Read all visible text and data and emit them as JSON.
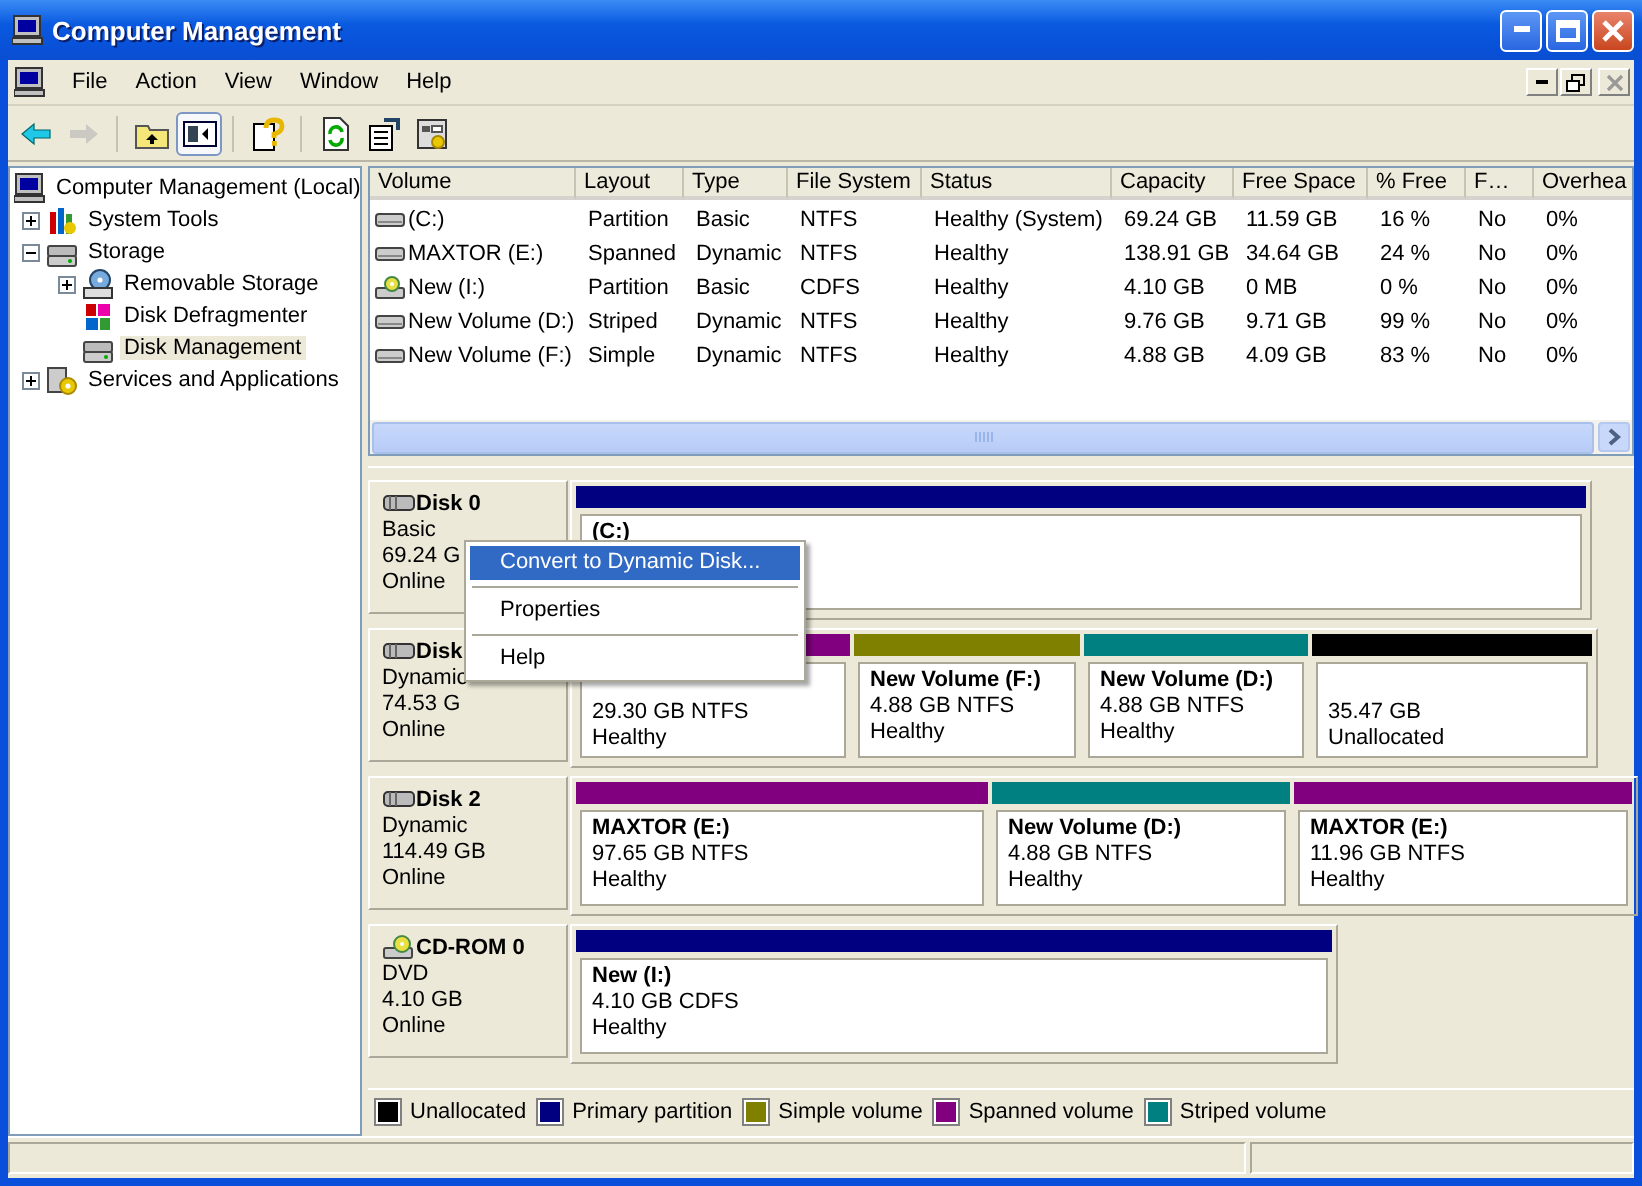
{
  "window": {
    "title": "Computer Management"
  },
  "menu": [
    "File",
    "Action",
    "View",
    "Window",
    "Help"
  ],
  "toolbar": [
    [
      {
        "kind": "back",
        "disabled": false,
        "pressed": false
      },
      {
        "kind": "forward",
        "disabled": true,
        "pressed": false
      }
    ],
    [
      {
        "kind": "up",
        "disabled": false,
        "pressed": false
      },
      {
        "kind": "tree",
        "disabled": false,
        "pressed": true
      }
    ],
    [
      {
        "kind": "help",
        "disabled": false,
        "pressed": false
      }
    ],
    [
      {
        "kind": "refresh",
        "disabled": false,
        "pressed": false
      },
      {
        "kind": "export",
        "disabled": false,
        "pressed": false
      },
      {
        "kind": "properties",
        "disabled": false,
        "pressed": false
      }
    ]
  ],
  "tree": [
    {
      "label": "Computer Management (Local)",
      "selected": false,
      "children": [
        {
          "label": "System Tools",
          "expanded": false,
          "selected": false
        },
        {
          "label": "Storage",
          "expanded": true,
          "selected": false,
          "children": [
            {
              "label": "Removable Storage",
              "expanded": false,
              "selected": false
            },
            {
              "label": "Disk Defragmenter",
              "selected": false
            },
            {
              "label": "Disk Management",
              "selected": true
            }
          ]
        },
        {
          "label": "Services and Applications",
          "expanded": false,
          "selected": false
        }
      ]
    }
  ],
  "volumes_table": {
    "columns": [
      "Volume",
      "Layout",
      "Type",
      "File System",
      "Status",
      "Capacity",
      "Free Space",
      "% Free",
      "F…",
      "Overhea"
    ],
    "rows": [
      {
        "cells": [
          " (C:)",
          "Partition",
          "Basic",
          "NTFS",
          "Healthy (System)",
          "69.24 GB",
          "11.59 GB",
          "16 %",
          "No",
          "0%"
        ]
      },
      {
        "cells": [
          "MAXTOR (E:)",
          "Spanned",
          "Dynamic",
          "NTFS",
          "Healthy",
          "138.91 GB",
          "34.64 GB",
          "24 %",
          "No",
          "0%"
        ]
      },
      {
        "cells": [
          "New (I:)",
          "Partition",
          "Basic",
          "CDFS",
          "Healthy",
          "4.10 GB",
          "0 MB",
          "0 %",
          "No",
          "0%"
        ]
      },
      {
        "cells": [
          "New Volume (D:)",
          "Striped",
          "Dynamic",
          "NTFS",
          "Healthy",
          "9.76 GB",
          "9.71 GB",
          "99 %",
          "No",
          "0%"
        ]
      },
      {
        "cells": [
          "New Volume (F:)",
          "Simple",
          "Dynamic",
          "NTFS",
          "Healthy",
          "4.88 GB",
          "4.09 GB",
          "83 %",
          "No",
          "0%"
        ]
      }
    ]
  },
  "disks": [
    {
      "name": "Disk 0",
      "type": "Basic",
      "capacity": "69.24 G",
      "status": "Online",
      "volumes": [
        {
          "color": "#000080",
          "name": "(C:)"
        }
      ]
    },
    {
      "name": "Disk",
      "type": "Dynamic",
      "capacity": "74.53 G",
      "status": "Online",
      "volumes": [
        {
          "color": "#800080",
          "size": "29.30 GB NTFS",
          "status": "Healthy"
        },
        {
          "color": "#808000",
          "name": "New Volume  (F:)",
          "size": "4.88 GB NTFS",
          "status": "Healthy"
        },
        {
          "color": "#008080",
          "name": "New Volume  (D:)",
          "size": "4.88 GB NTFS",
          "status": "Healthy"
        },
        {
          "color": "#000000",
          "size": "35.47 GB",
          "status": "Unallocated"
        }
      ]
    },
    {
      "name": "Disk 2",
      "type": "Dynamic",
      "capacity": "114.49 GB",
      "status": "Online",
      "volumes": [
        {
          "color": "#800080",
          "name": "MAXTOR  (E:)",
          "size": "97.65 GB NTFS",
          "status": "Healthy"
        },
        {
          "color": "#008080",
          "name": "New Volume  (D:)",
          "size": "4.88 GB NTFS",
          "status": "Healthy"
        },
        {
          "color": "#800080",
          "name": "MAXTOR  (E:)",
          "size": "11.96 GB NTFS",
          "status": "Healthy"
        }
      ]
    },
    {
      "name": "CD-ROM 0",
      "type": "DVD",
      "capacity": "4.10 GB",
      "status": "Online",
      "volumes": [
        {
          "color": "#000080",
          "name": "New  (I:)",
          "size": "4.10 GB CDFS",
          "status": "Healthy"
        }
      ]
    }
  ],
  "context_menu": [
    {
      "label": "Convert to Dynamic Disk...",
      "selected": true
    },
    {
      "label": "Properties",
      "selected": false
    },
    {
      "label": "Help",
      "selected": false
    }
  ],
  "legend": [
    {
      "color": "#000000",
      "label": "Unallocated"
    },
    {
      "color": "#000080",
      "label": "Primary partition"
    },
    {
      "color": "#808000",
      "label": "Simple volume"
    },
    {
      "color": "#800080",
      "label": "Spanned volume"
    },
    {
      "color": "#008080",
      "label": "Striped volume"
    }
  ]
}
